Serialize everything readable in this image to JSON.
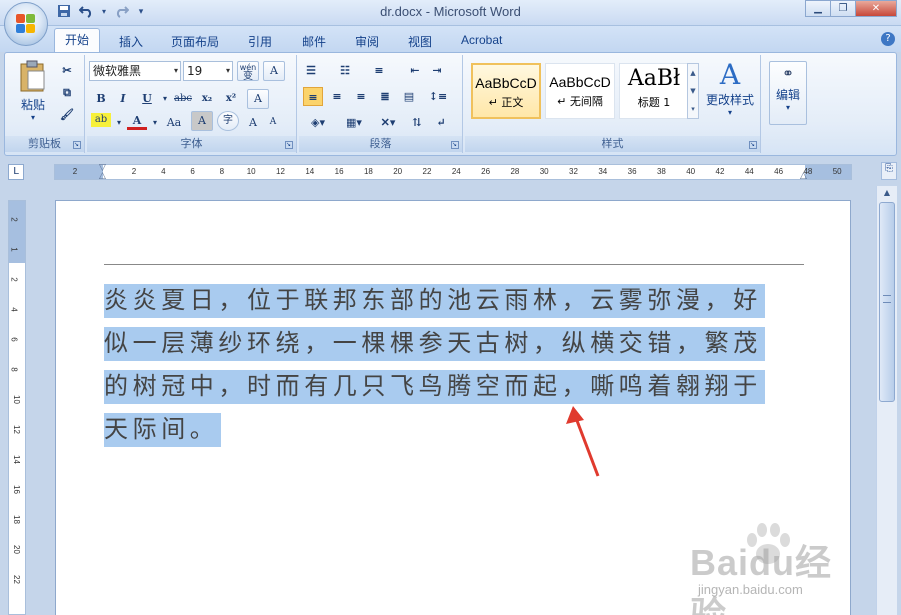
{
  "window": {
    "title": "dr.docx - Microsoft Word",
    "controls": [
      "minimize-icon",
      "restore-icon",
      "close-icon"
    ]
  },
  "quick_access": [
    "save-icon",
    "undo-icon",
    "redo-icon",
    "customize-icon"
  ],
  "tabs": [
    {
      "label": "开始",
      "active": true
    },
    {
      "label": "插入"
    },
    {
      "label": "页面布局"
    },
    {
      "label": "引用"
    },
    {
      "label": "邮件"
    },
    {
      "label": "审阅"
    },
    {
      "label": "视图"
    },
    {
      "label": "Acrobat"
    }
  ],
  "ribbon": {
    "clipboard": {
      "label": "剪贴板",
      "paste_label": "粘贴"
    },
    "font": {
      "label": "字体",
      "font_name": "微软雅黑",
      "font_size": "19",
      "phonetic": "wén",
      "phonetic_char": "变",
      "bold": "B",
      "italic": "I",
      "underline": "U",
      "strike": "abc",
      "subscript": "x₂",
      "superscript": "x²",
      "clear_format": "A",
      "highlight": "ab",
      "font_color": "A",
      "change_case": "Aa",
      "char_shading": "A",
      "enclose": "字",
      "grow": "A",
      "shrink": "A"
    },
    "paragraph": {
      "label": "段落"
    },
    "styles": {
      "label": "样式",
      "items": [
        {
          "sample": "AaBbCcD",
          "name": "↵ 正文",
          "selected": true
        },
        {
          "sample": "AaBbCcD",
          "name": "↵ 无间隔"
        },
        {
          "sample": "AaBł",
          "name": "标题 1"
        }
      ],
      "change_styles": "更改样式"
    },
    "editing": {
      "label": "编辑"
    }
  },
  "ruler": {
    "corner": "L",
    "ticks": [
      "2",
      "2",
      "4",
      "6",
      "8",
      "10",
      "12",
      "14",
      "16",
      "18",
      "20",
      "22",
      "24",
      "26",
      "28",
      "30",
      "32",
      "34",
      "36",
      "38",
      "40",
      "42",
      "44",
      "46",
      "48",
      "50"
    ],
    "vticks": [
      "2",
      "1",
      "2",
      "4",
      "6",
      "8",
      "10",
      "12",
      "14",
      "16",
      "18",
      "20",
      "22"
    ]
  },
  "document": {
    "text": "炎炎夏日，位于联邦东部的池云雨林，云雾弥漫，好似一层薄纱环绕，一棵棵参天古树，纵横交错，繁茂的树冠中，时而有几只飞鸟腾空而起，嘶鸣着翱翔于天际间。"
  },
  "watermark": {
    "brand": "Baidu经验",
    "url": "jingyan.baidu.com"
  },
  "colors": {
    "selection": "#a9cbef",
    "arrow": "#e03a2e",
    "ribbon_text": "#15428b"
  }
}
